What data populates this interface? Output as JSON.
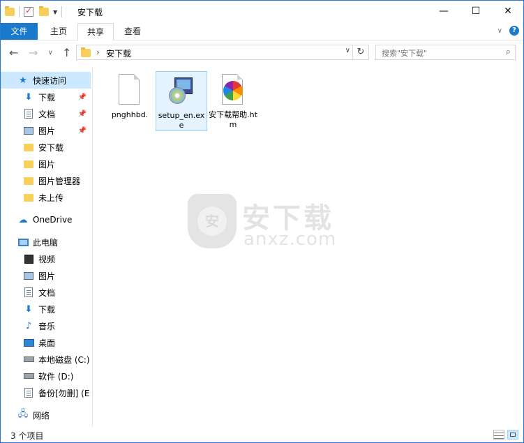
{
  "window": {
    "title": "安下载",
    "controls": {
      "minimize": "—",
      "maximize": "☐",
      "close": "✕"
    }
  },
  "ribbon": {
    "tabs": [
      {
        "label": "文件"
      },
      {
        "label": "主页"
      },
      {
        "label": "共享"
      },
      {
        "label": "查看"
      }
    ]
  },
  "address": {
    "crumb": "安下载",
    "search_placeholder": "搜索\"安下载\""
  },
  "sidebar": {
    "items": [
      {
        "label": "快速访问",
        "icon": "star-icon"
      },
      {
        "label": "下载",
        "icon": "download-arrow-icon"
      },
      {
        "label": "文档",
        "icon": "document-icon"
      },
      {
        "label": "图片",
        "icon": "picture-icon"
      },
      {
        "label": "安下载",
        "icon": "folder-icon"
      },
      {
        "label": "图片",
        "icon": "folder-icon"
      },
      {
        "label": "图片管理器",
        "icon": "folder-icon"
      },
      {
        "label": "未上传",
        "icon": "folder-icon"
      },
      {
        "label": "OneDrive",
        "icon": "cloud-icon"
      },
      {
        "label": "此电脑",
        "icon": "computer-icon"
      },
      {
        "label": "视频",
        "icon": "video-icon"
      },
      {
        "label": "图片",
        "icon": "picture-icon"
      },
      {
        "label": "文档",
        "icon": "document-icon"
      },
      {
        "label": "下载",
        "icon": "download-arrow-icon"
      },
      {
        "label": "音乐",
        "icon": "music-icon"
      },
      {
        "label": "桌面",
        "icon": "desktop-icon"
      },
      {
        "label": "本地磁盘 (C:)",
        "icon": "drive-icon"
      },
      {
        "label": "软件 (D:)",
        "icon": "drive-icon"
      },
      {
        "label": "备份[勿删] (E:",
        "icon": "document-icon"
      },
      {
        "label": "网络",
        "icon": "network-icon"
      }
    ]
  },
  "files": [
    {
      "name": "pnghhbd.",
      "icon": "blank-file-icon"
    },
    {
      "name": "setup_en.exe",
      "icon": "installer-icon"
    },
    {
      "name": "安下载帮助.htm",
      "icon": "color-wheel-icon"
    }
  ],
  "watermark": {
    "cn": "安下载",
    "en": "anxz.com",
    "shield": "安"
  },
  "status": {
    "item_count": "3 个项目"
  },
  "colors": {
    "accent": "#1979ca",
    "selection": "#cce8ff",
    "border": "#2b79d6"
  }
}
